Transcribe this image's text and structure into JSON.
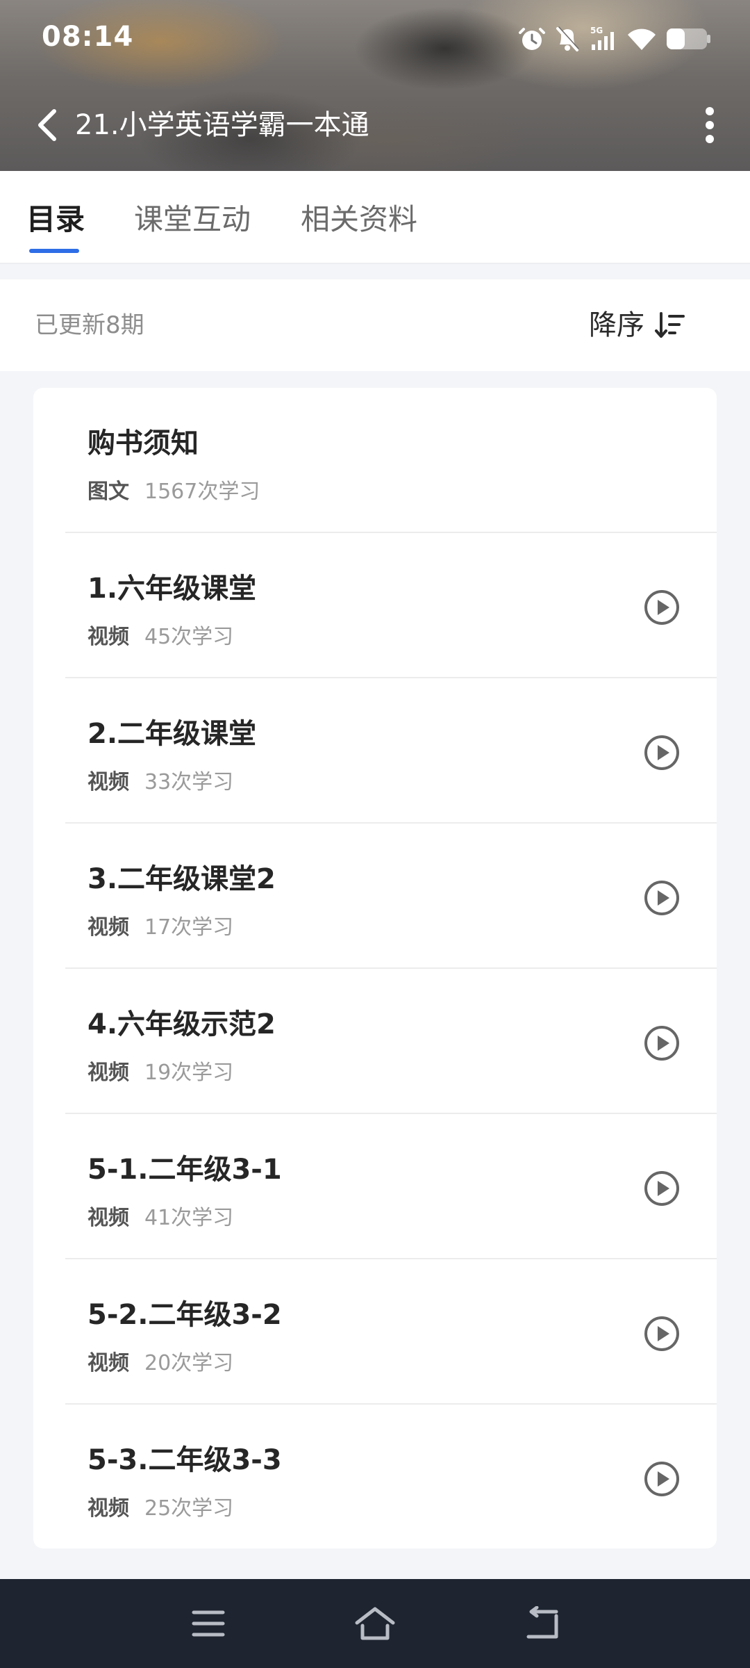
{
  "status_bar": {
    "time": "08:14",
    "icons": [
      "alarm-icon",
      "mute-icon",
      "signal-5g-icon",
      "wifi-icon",
      "battery-icon"
    ],
    "network_label": "5G"
  },
  "header": {
    "title": "21.小学英语学霸一本通",
    "back_icon": "chevron-left-icon",
    "more_icon": "more-vertical-icon"
  },
  "tabs": [
    {
      "label": "目录",
      "active": true
    },
    {
      "label": "课堂互动",
      "active": false
    },
    {
      "label": "相关资料",
      "active": false
    }
  ],
  "info": {
    "update_text": "已更新8期",
    "sort_label": "降序",
    "sort_icon": "sort-descending-icon"
  },
  "items": [
    {
      "title": "购书须知",
      "type": "图文",
      "count": "1567次学习",
      "has_play": false
    },
    {
      "title": "1.六年级课堂",
      "type": "视频",
      "count": "45次学习",
      "has_play": true
    },
    {
      "title": "2.二年级课堂",
      "type": "视频",
      "count": "33次学习",
      "has_play": true
    },
    {
      "title": "3.二年级课堂2",
      "type": "视频",
      "count": "17次学习",
      "has_play": true
    },
    {
      "title": "4.六年级示范2",
      "type": "视频",
      "count": "19次学习",
      "has_play": true
    },
    {
      "title": "5-1.二年级3-1",
      "type": "视频",
      "count": "41次学习",
      "has_play": true
    },
    {
      "title": "5-2.二年级3-2",
      "type": "视频",
      "count": "20次学习",
      "has_play": true
    },
    {
      "title": "5-3.二年级3-3",
      "type": "视频",
      "count": "25次学习",
      "has_play": true
    }
  ],
  "nav": {
    "icons": [
      "menu-icon",
      "home-icon",
      "back-icon"
    ]
  },
  "colors": {
    "accent": "#2e6de6",
    "nav_background": "#1e2530",
    "page_background": "#f4f5f8"
  }
}
